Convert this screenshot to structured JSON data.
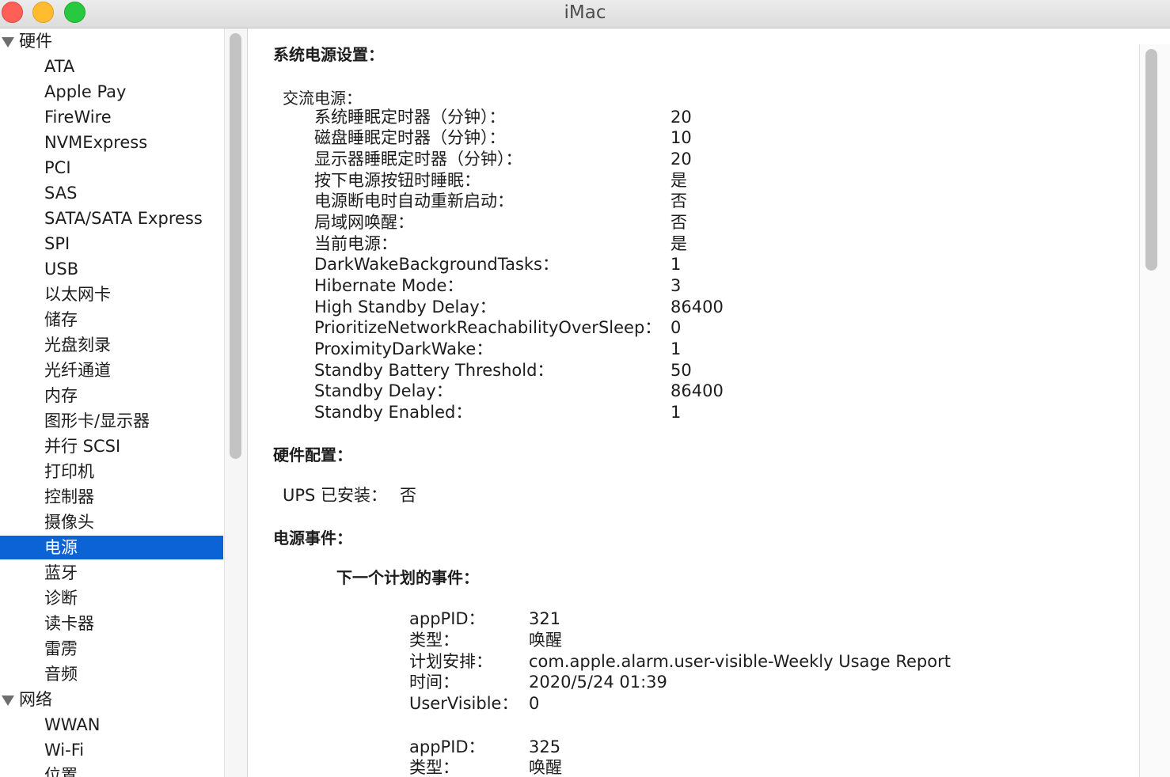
{
  "window": {
    "title": "iMac"
  },
  "sidebar": {
    "hardware_group": "硬件",
    "hardware_items": [
      "ATA",
      "Apple Pay",
      "FireWire",
      "NVMExpress",
      "PCI",
      "SAS",
      "SATA/SATA Express",
      "SPI",
      "USB",
      "以太网卡",
      "储存",
      "光盘刻录",
      "光纤通道",
      "内存",
      "图形卡/显示器",
      "并行 SCSI",
      "打印机",
      "控制器",
      "摄像头",
      "电源",
      "蓝牙",
      "诊断",
      "读卡器",
      "雷雳",
      "音频"
    ],
    "selected_item": "电源",
    "network_group": "网络",
    "network_items": [
      "WWAN",
      "Wi-Fi",
      "位置"
    ]
  },
  "content": {
    "power_settings": {
      "heading": "系统电源设置：",
      "ac_power_label": "交流电源：",
      "rows": [
        {
          "key": "系统睡眠定时器（分钟）：",
          "value": "20"
        },
        {
          "key": "磁盘睡眠定时器（分钟）：",
          "value": "10"
        },
        {
          "key": "显示器睡眠定时器（分钟）：",
          "value": "20"
        },
        {
          "key": "按下电源按钮时睡眠：",
          "value": "是"
        },
        {
          "key": "电源断电时自动重新启动：",
          "value": "否"
        },
        {
          "key": "局域网唤醒：",
          "value": "否"
        },
        {
          "key": "当前电源：",
          "value": "是"
        },
        {
          "key": "DarkWakeBackgroundTasks：",
          "value": "1"
        },
        {
          "key": "Hibernate Mode：",
          "value": "3"
        },
        {
          "key": "High Standby Delay：",
          "value": "86400"
        },
        {
          "key": "PrioritizeNetworkReachabilityOverSleep：",
          "value": "0"
        },
        {
          "key": "ProximityDarkWake：",
          "value": "1"
        },
        {
          "key": "Standby Battery Threshold：",
          "value": "50"
        },
        {
          "key": "Standby Delay：",
          "value": "86400"
        },
        {
          "key": "Standby Enabled：",
          "value": "1"
        }
      ]
    },
    "hardware_config": {
      "heading": "硬件配置：",
      "ups_label": "UPS 已安装：",
      "ups_value": "否"
    },
    "power_events": {
      "heading": "电源事件：",
      "next_events_label": "下一个计划的事件：",
      "events": [
        [
          {
            "key": "appPID：",
            "value": "321"
          },
          {
            "key": "类型：",
            "value": "唤醒"
          },
          {
            "key": "计划安排：",
            "value": "com.apple.alarm.user-visible-Weekly Usage Report"
          },
          {
            "key": "时间：",
            "value": "2020/5/24 01:39"
          },
          {
            "key": "UserVisible：",
            "value": "0"
          }
        ],
        [
          {
            "key": "appPID：",
            "value": "325"
          },
          {
            "key": "类型：",
            "value": "唤醒"
          }
        ]
      ]
    }
  },
  "colors": {
    "selection": "#0b63d6",
    "close": "#fe5f57",
    "minimize": "#febc2e",
    "zoom": "#28c840"
  }
}
